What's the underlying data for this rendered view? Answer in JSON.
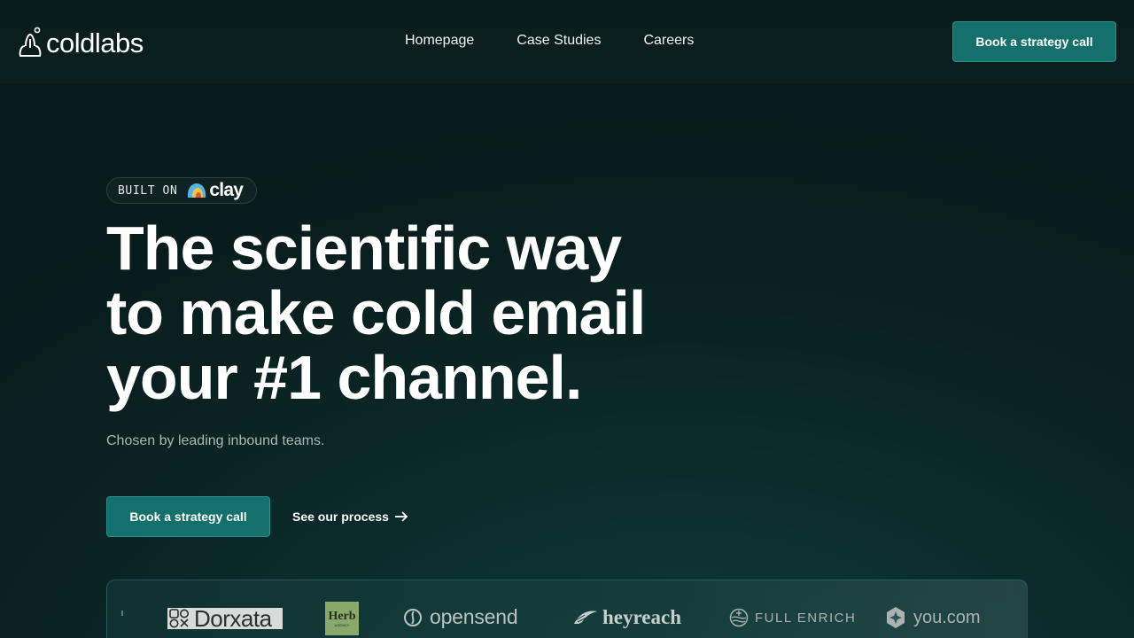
{
  "header": {
    "logo_text": "coldlabs",
    "nav": [
      {
        "label": "Homepage"
      },
      {
        "label": "Case Studies"
      },
      {
        "label": "Careers"
      }
    ],
    "cta_label": "Book a strategy call"
  },
  "hero": {
    "badge_label": "BUILT ON",
    "badge_brand": "clay",
    "title_lines": [
      "The scientific way",
      "to make cold email",
      "your #1 channel."
    ],
    "subtitle": "Chosen by leading inbound teams.",
    "cta_label": "Book a strategy call",
    "secondary_link": "See our process",
    "secondary_icon": "arrow-right-icon"
  },
  "logos": [
    {
      "name": "Dorxata",
      "icon": "dorxata-mark-icon"
    },
    {
      "name": "Herb",
      "sub": "AGENCY"
    },
    {
      "name": "opensend",
      "icon": "opensend-mark-icon"
    },
    {
      "name": "heyreach",
      "icon": "heyreach-wing-icon"
    },
    {
      "name": "FULL ENRICH",
      "icon": "fullenrich-globe-icon"
    },
    {
      "name": "you.com",
      "icon": "youcom-star-icon"
    }
  ],
  "colors": {
    "background": "#0b2323",
    "accent": "#14706b",
    "accent_border": "#2b8e87",
    "muted_text": "#a9b8b6"
  }
}
